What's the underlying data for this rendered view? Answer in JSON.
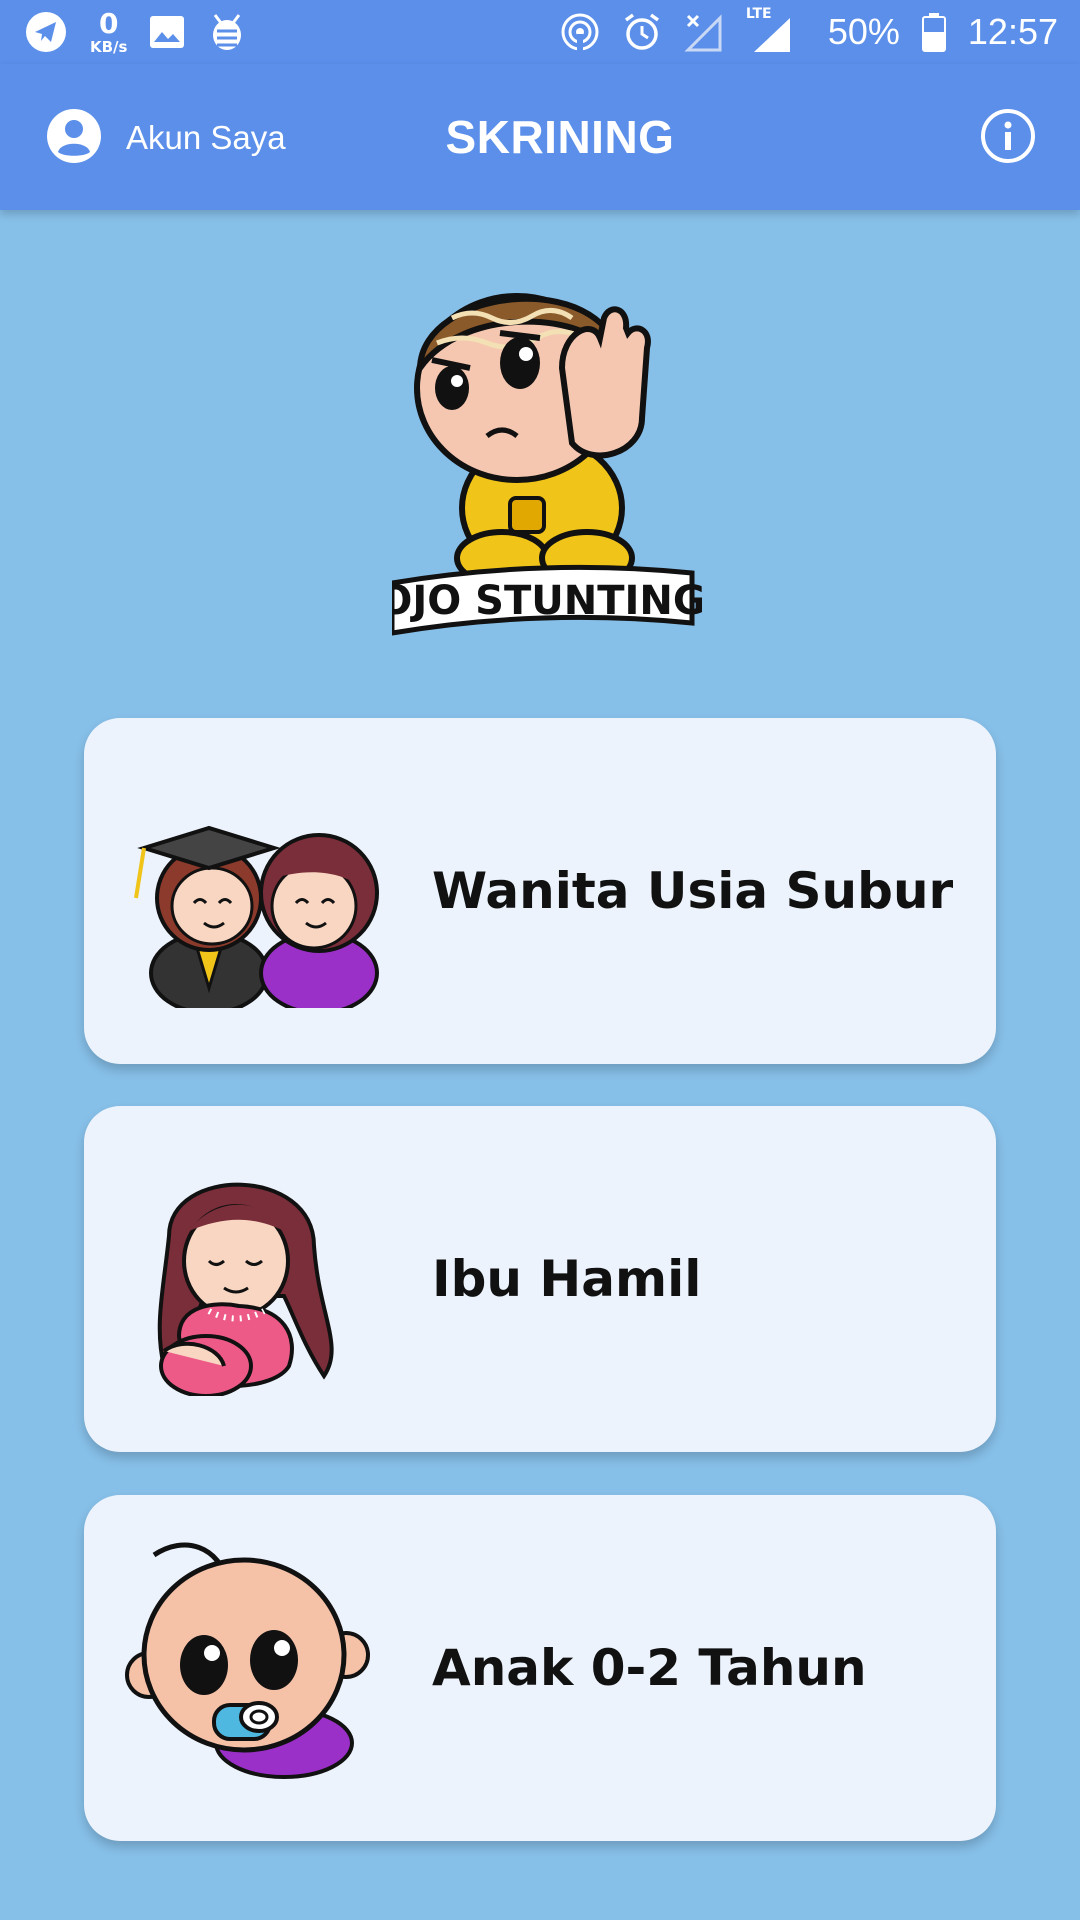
{
  "status_bar": {
    "net_speed_value": "0",
    "net_speed_unit": "KB/s",
    "network_type": "LTE",
    "battery": "50%",
    "time": "12:57",
    "icons": [
      "telegram-icon",
      "gallery-icon",
      "bug-icon",
      "hotspot-icon",
      "alarm-icon",
      "no-signal-icon",
      "lte-signal-icon",
      "battery-icon"
    ]
  },
  "app_bar": {
    "account_label": "Akun Saya",
    "title": "SKRINING",
    "account_icon": "account-circle-icon",
    "info_icon": "info-icon"
  },
  "mascot": {
    "logo_text": "OJO STUNTING"
  },
  "menu": [
    {
      "label": "Wanita Usia Subur",
      "icon": "women-illustration"
    },
    {
      "label": "Ibu Hamil",
      "icon": "pregnant-woman-illustration"
    },
    {
      "label": "Anak 0-2 Tahun",
      "icon": "baby-illustration"
    }
  ],
  "colors": {
    "app_bar": "#5b8fea",
    "background": "#86bfe8",
    "card": "#ecf3fc"
  }
}
